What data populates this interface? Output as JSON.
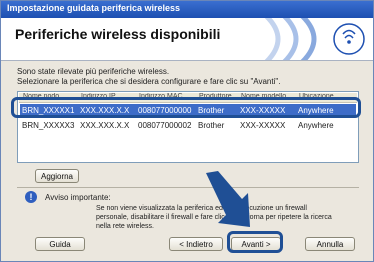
{
  "window": {
    "title": "Impostazione guidata periferica wireless"
  },
  "banner": {
    "heading": "Periferiche wireless disponibili"
  },
  "description": {
    "line1": "Sono state rilevate più periferiche wireless.",
    "line2": "Selezionare la periferica che si desidera configurare e fare clic su \"Avanti\"."
  },
  "list": {
    "header": [
      "Nome nodo",
      "Indirizzo IP",
      "Indirizzo MAC",
      "Produttore",
      "Nome modello",
      "Ubicazione"
    ],
    "rows": [
      {
        "name": "BRN_XXXXX1",
        "ip": "XXX.XXX.X.X",
        "mac": "008077000000",
        "vendor": "Brother",
        "model": "XXX-XXXXX",
        "location": "Anywhere",
        "selected": true
      },
      {
        "name": "BRN_XXXXX3",
        "ip": "XXX.XXX.X.X",
        "mac": "008077000002",
        "vendor": "Brother",
        "model": "XXX-XXXXX",
        "location": "Anywhere",
        "selected": false
      }
    ]
  },
  "buttons": {
    "refresh": "Aggiorna",
    "help": "Guida",
    "back": "< Indietro",
    "next": "Avanti >",
    "cancel": "Annulla"
  },
  "notice": {
    "title": "Avviso importante:",
    "text": "Se non viene visualizzata la periferica ed è in esecuzione un firewall personale, disabilitare il firewall e fare clic su Aggiorna per ripetere la ricerca nella rete wireless."
  },
  "colors": {
    "title_bar": "#1d4fb1",
    "selection": "#3d6cc8",
    "callout": "#1f4f95"
  },
  "icons": {
    "banner": "wireless-signal-icon",
    "notice": "info-icon",
    "pointer": "arrow-pointer-icon"
  }
}
